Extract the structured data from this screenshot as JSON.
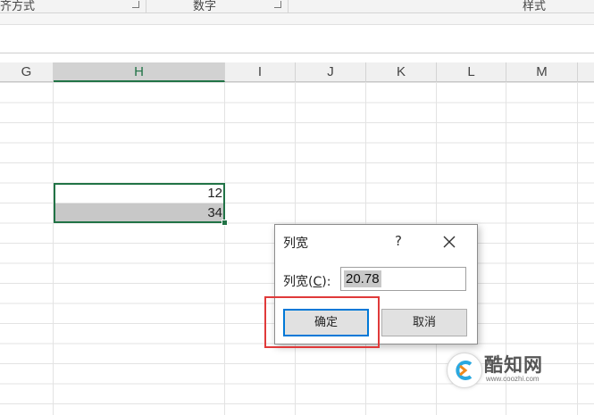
{
  "ribbon": {
    "groups": [
      {
        "label": "齐方式"
      },
      {
        "label": "数字"
      },
      {
        "label": "样式"
      }
    ]
  },
  "columns": [
    "G",
    "H",
    "I",
    "J",
    "K",
    "L",
    "M"
  ],
  "selected_column": "H",
  "cells": {
    "H8": "12",
    "H9": "34"
  },
  "dialog": {
    "title": "列宽",
    "help": "?",
    "field_label_prefix": "列宽(",
    "field_label_key": "C",
    "field_label_suffix": "):",
    "value": "20.78",
    "ok_label": "确定",
    "cancel_label": "取消"
  },
  "watermark": {
    "name": "酷知网",
    "url": "www.coozhi.com"
  },
  "colors": {
    "excel_green": "#217346",
    "highlight_red": "#e03a3a",
    "focus_blue": "#0078d7"
  }
}
